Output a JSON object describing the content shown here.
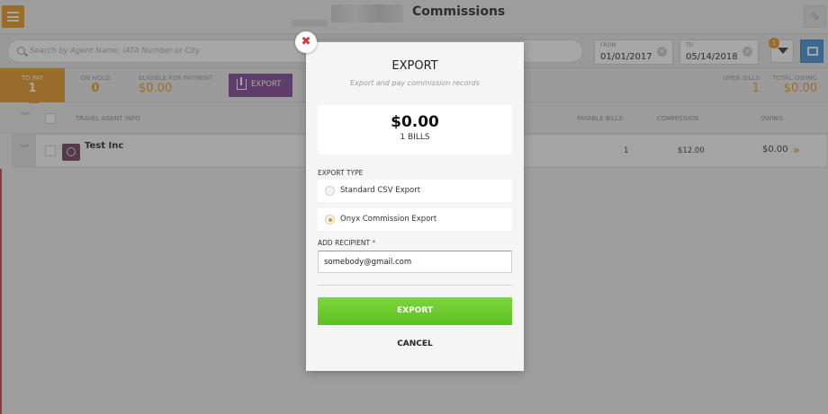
{
  "header": {
    "title": "Commissions"
  },
  "search": {
    "placeholder": "Search by Agent Name, IATA Number or City"
  },
  "dates": {
    "from_label": "FROM",
    "from_value": "01/01/2017",
    "to_label": "TO",
    "to_value": "05/14/2018"
  },
  "filter": {
    "badge": "1"
  },
  "tabs": [
    {
      "label": "TO PAY",
      "count": "1",
      "active": true
    },
    {
      "label": "ON HOLD",
      "count": "0",
      "active": false
    }
  ],
  "eligible": {
    "label": "ELIGIBLE FOR PAYMENT",
    "value": "$0.00"
  },
  "export_button": {
    "label": "EXPORT"
  },
  "summary": {
    "open_bills_label": "OPEN BILLS",
    "open_bills_value": "1",
    "total_owing_label": "TOTAL OWING",
    "total_owing_value": "$0.00"
  },
  "table": {
    "columns": {
      "agent": "TRAVEL AGENT INFO",
      "payable_bills": "PAYABLE BILLS",
      "commission": "COMMISSION",
      "owing": "OWING"
    },
    "rows": [
      {
        "agent_name": "Test Inc",
        "payable_bills": "1",
        "commission": "$12.00",
        "owing": "$0.00"
      }
    ]
  },
  "modal": {
    "close_glyph": "✖",
    "title": "EXPORT",
    "subtitle": "Export and pay commission records",
    "amount": "$0.00",
    "bills": "1 BILLS",
    "export_type_label": "EXPORT TYPE",
    "options": [
      {
        "label": "Standard CSV Export",
        "selected": false
      },
      {
        "label": "Onyx Commission Export",
        "selected": true
      }
    ],
    "recipient_label": "ADD RECIPIENT",
    "recipient_required": "*",
    "recipient_value": "somebody@gmail.com",
    "export_label": "EXPORT",
    "cancel_label": "CANCEL"
  },
  "colors": {
    "accent_orange": "#e8941c",
    "export_purple": "#7a3f8e",
    "confirm_green": "#6ccb30",
    "view_blue": "#3b8fd9"
  }
}
